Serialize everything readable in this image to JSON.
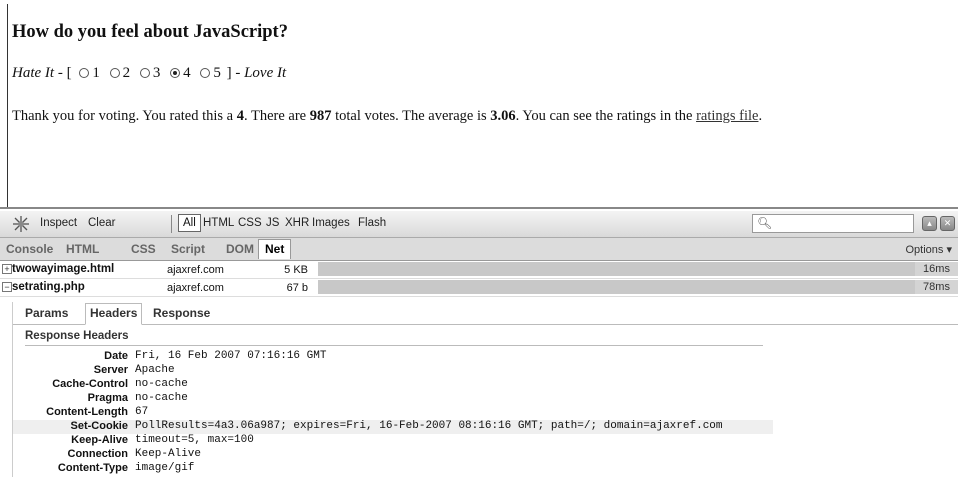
{
  "page": {
    "question": "How do you feel about JavaScript?",
    "hate_label": "Hate It",
    "love_label": "Love It",
    "options": [
      "1",
      "2",
      "3",
      "4",
      "5"
    ],
    "selected": "4",
    "thanks_prefix": "Thank you for voting. You rated this a ",
    "rated": "4",
    "thanks_mid1": ". There are ",
    "votes": "987",
    "thanks_mid2": " total votes. The average is ",
    "average": "3.06",
    "thanks_mid3": ". You can see the ratings in the ",
    "link_text": "ratings file",
    "thanks_end": "."
  },
  "firebug": {
    "toolbar": [
      "Inspect",
      "Clear",
      "All",
      "HTML",
      "CSS",
      "JS",
      "XHR",
      "Images",
      "Flash"
    ],
    "tabs": [
      "Console",
      "HTML",
      "CSS",
      "Script",
      "DOM",
      "Net"
    ],
    "active_tab": "Net",
    "options_label": "Options ▾",
    "requests": [
      {
        "name": "twowayimage.html",
        "domain": "ajaxref.com",
        "size": "5 KB",
        "time": "16ms",
        "expanded": "+"
      },
      {
        "name": "setrating.php",
        "domain": "ajaxref.com",
        "size": "67 b",
        "time": "78ms",
        "expanded": "−"
      }
    ],
    "subtabs": [
      "Params",
      "Headers",
      "Response"
    ],
    "response_title": "Response Headers",
    "headers": [
      {
        "k": "Date",
        "v": "Fri, 16 Feb 2007 07:16:16 GMT"
      },
      {
        "k": "Server",
        "v": "Apache"
      },
      {
        "k": "Cache-Control",
        "v": "no-cache"
      },
      {
        "k": "Pragma",
        "v": "no-cache"
      },
      {
        "k": "Content-Length",
        "v": "67"
      },
      {
        "k": "Set-Cookie",
        "v": "PollResults=4a3.06a987; expires=Fri, 16-Feb-2007 08:16:16 GMT; path=/; domain=ajaxref.com"
      },
      {
        "k": "Keep-Alive",
        "v": "timeout=5, max=100"
      },
      {
        "k": "Connection",
        "v": "Keep-Alive"
      },
      {
        "k": "Content-Type",
        "v": "image/gif"
      }
    ]
  }
}
